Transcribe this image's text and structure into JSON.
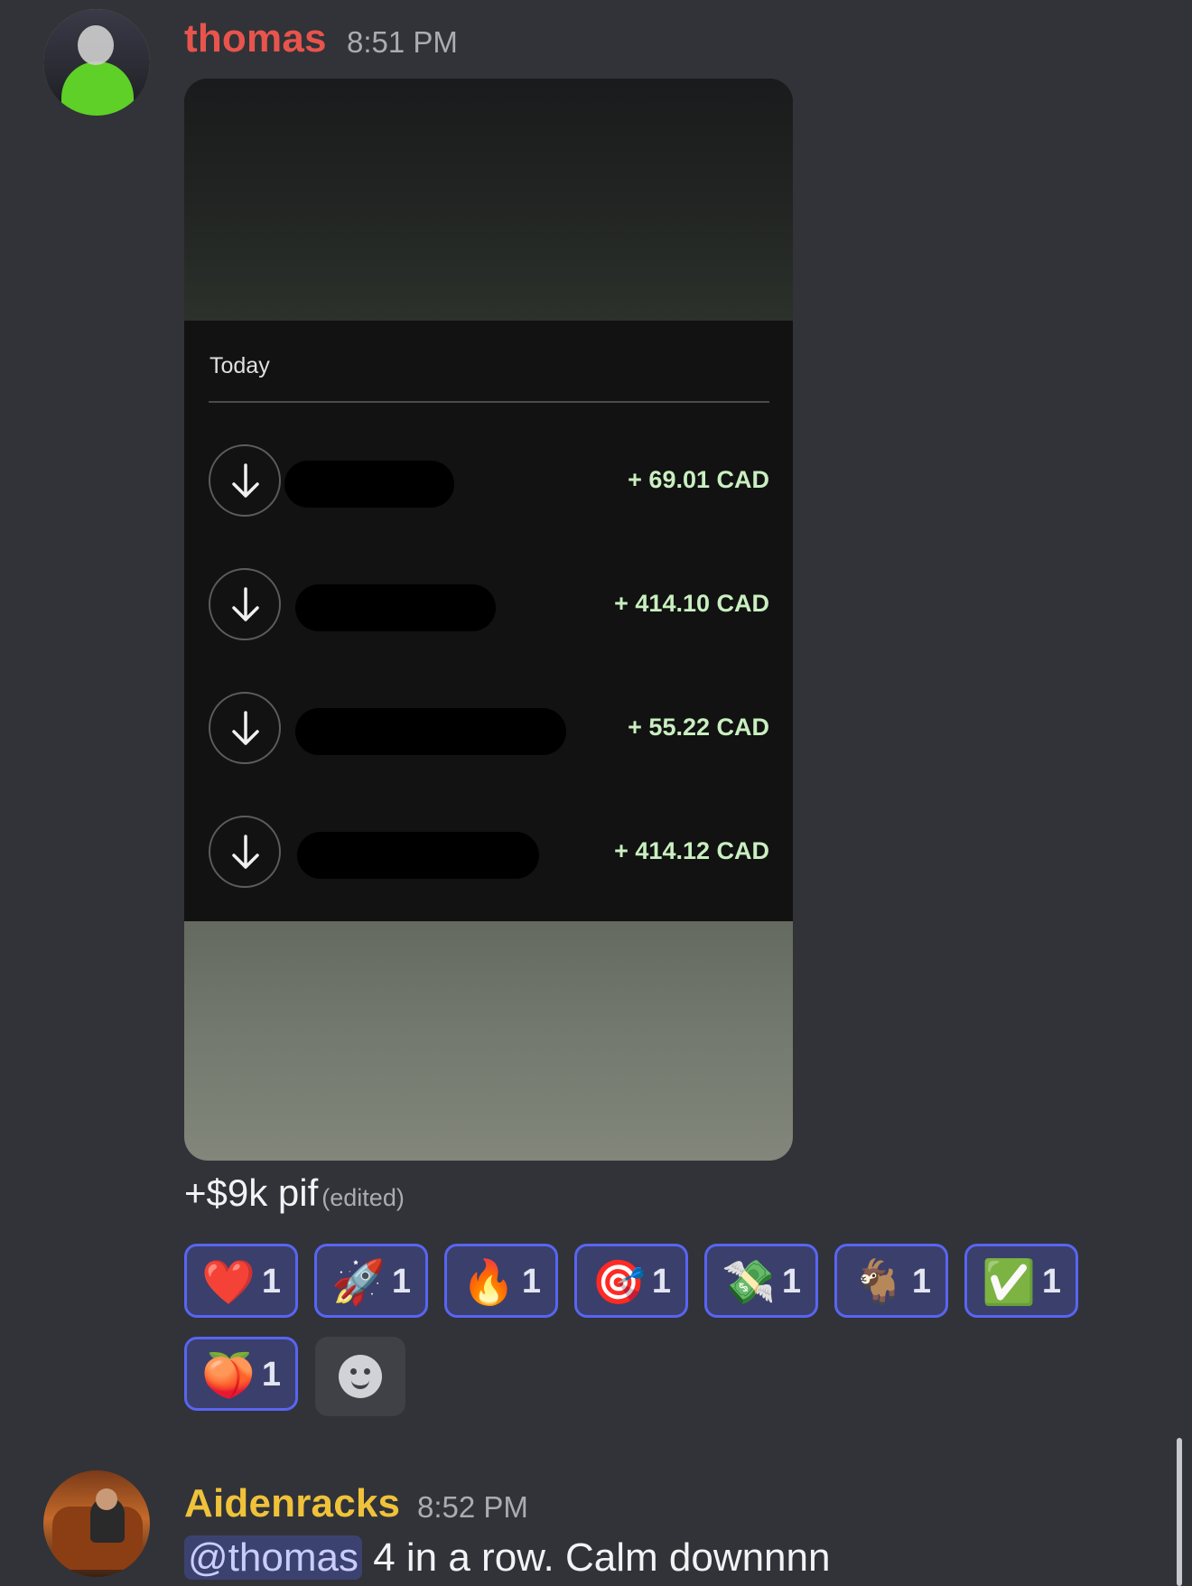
{
  "messages": [
    {
      "username": "thomas",
      "timestamp": "8:51 PM",
      "attachment": {
        "section_label": "Today",
        "transactions": [
          {
            "amount": "+ 69.01 CAD"
          },
          {
            "amount": "+ 414.10 CAD"
          },
          {
            "amount": "+ 55.22 CAD"
          },
          {
            "amount": "+ 414.12 CAD"
          }
        ]
      },
      "caption": "+$9k pif",
      "edited_label": "(edited)",
      "reactions": [
        {
          "emoji": "❤️",
          "icon": "heart-emoji",
          "count": "1"
        },
        {
          "emoji": "🚀",
          "icon": "rocket-emoji",
          "count": "1"
        },
        {
          "emoji": "🔥",
          "icon": "fire-emoji",
          "count": "1"
        },
        {
          "emoji": "🎯",
          "icon": "bullseye-emoji",
          "count": "1"
        },
        {
          "emoji": "💸",
          "icon": "money-with-wings-emoji",
          "count": "1"
        },
        {
          "emoji": "🐐",
          "icon": "goat-emoji",
          "count": "1"
        },
        {
          "emoji": "✅",
          "icon": "check-mark-emoji",
          "count": "1"
        },
        {
          "emoji": "🍑",
          "icon": "peach-emoji",
          "count": "1"
        }
      ]
    },
    {
      "username": "Aidenracks",
      "timestamp": "8:52 PM",
      "mention": "@thomas",
      "text": " 4 in a row. Calm downnnn"
    }
  ],
  "colors": {
    "background": "#313338",
    "username_1": "#e8544c",
    "username_2": "#f0c23a",
    "reaction_border": "#5865f2",
    "amount_green": "#c9efc0"
  }
}
